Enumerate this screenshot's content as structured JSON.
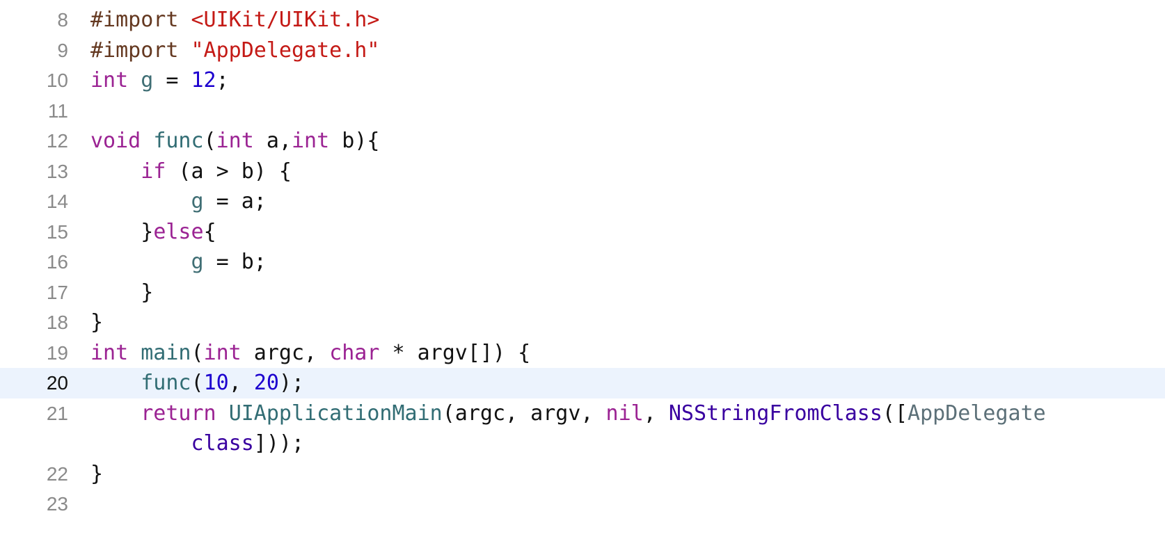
{
  "editor": {
    "lines": [
      {
        "num": "8",
        "tokens": [
          {
            "text": "#import ",
            "kind": "pp"
          },
          {
            "text": "<UIKit/UIKit.h>",
            "kind": "str"
          }
        ]
      },
      {
        "num": "9",
        "tokens": [
          {
            "text": "#import ",
            "kind": "pp"
          },
          {
            "text": "\"AppDelegate.h\"",
            "kind": "str"
          }
        ]
      },
      {
        "num": "10",
        "tokens": [
          {
            "text": "int",
            "kind": "kw"
          },
          {
            "text": " ",
            "kind": "plain"
          },
          {
            "text": "g",
            "kind": "gv"
          },
          {
            "text": " = ",
            "kind": "plain"
          },
          {
            "text": "12",
            "kind": "num"
          },
          {
            "text": ";",
            "kind": "plain"
          }
        ]
      },
      {
        "num": "11",
        "tokens": []
      },
      {
        "num": "12",
        "tokens": [
          {
            "text": "void",
            "kind": "kw"
          },
          {
            "text": " ",
            "kind": "plain"
          },
          {
            "text": "func",
            "kind": "fn"
          },
          {
            "text": "(",
            "kind": "plain"
          },
          {
            "text": "int",
            "kind": "kw"
          },
          {
            "text": " a,",
            "kind": "plain"
          },
          {
            "text": "int",
            "kind": "kw"
          },
          {
            "text": " b){",
            "kind": "plain"
          }
        ]
      },
      {
        "num": "13",
        "tokens": [
          {
            "text": "    ",
            "kind": "plain"
          },
          {
            "text": "if",
            "kind": "kw"
          },
          {
            "text": " (a > b) {",
            "kind": "plain"
          }
        ]
      },
      {
        "num": "14",
        "tokens": [
          {
            "text": "        ",
            "kind": "plain"
          },
          {
            "text": "g",
            "kind": "gv"
          },
          {
            "text": " = a;",
            "kind": "plain"
          }
        ]
      },
      {
        "num": "15",
        "tokens": [
          {
            "text": "    }",
            "kind": "plain"
          },
          {
            "text": "else",
            "kind": "kw"
          },
          {
            "text": "{",
            "kind": "plain"
          }
        ]
      },
      {
        "num": "16",
        "tokens": [
          {
            "text": "        ",
            "kind": "plain"
          },
          {
            "text": "g",
            "kind": "gv"
          },
          {
            "text": " = b;",
            "kind": "plain"
          }
        ]
      },
      {
        "num": "17",
        "tokens": [
          {
            "text": "    }",
            "kind": "plain"
          }
        ]
      },
      {
        "num": "18",
        "tokens": [
          {
            "text": "}",
            "kind": "plain"
          }
        ]
      },
      {
        "num": "19",
        "tokens": [
          {
            "text": "int",
            "kind": "kw"
          },
          {
            "text": " ",
            "kind": "plain"
          },
          {
            "text": "main",
            "kind": "fn"
          },
          {
            "text": "(",
            "kind": "plain"
          },
          {
            "text": "int",
            "kind": "kw"
          },
          {
            "text": " argc, ",
            "kind": "plain"
          },
          {
            "text": "char",
            "kind": "kw"
          },
          {
            "text": " * argv[]) {",
            "kind": "plain"
          }
        ]
      },
      {
        "num": "20",
        "current": true,
        "tokens": [
          {
            "text": "    ",
            "kind": "plain"
          },
          {
            "text": "func",
            "kind": "fn"
          },
          {
            "text": "(",
            "kind": "plain"
          },
          {
            "text": "10",
            "kind": "num"
          },
          {
            "text": ", ",
            "kind": "plain"
          },
          {
            "text": "20",
            "kind": "num"
          },
          {
            "text": ");",
            "kind": "plain"
          }
        ]
      },
      {
        "num": "21",
        "tokens": [
          {
            "text": "    ",
            "kind": "plain"
          },
          {
            "text": "return",
            "kind": "kw"
          },
          {
            "text": " ",
            "kind": "plain"
          },
          {
            "text": "UIApplicationMain",
            "kind": "fn"
          },
          {
            "text": "(argc, argv, ",
            "kind": "plain"
          },
          {
            "text": "nil",
            "kind": "kw"
          },
          {
            "text": ", ",
            "kind": "plain"
          },
          {
            "text": "NSStringFromClass",
            "kind": "sys"
          },
          {
            "text": "([",
            "kind": "plain"
          },
          {
            "text": "AppDelegate",
            "kind": "cls"
          }
        ],
        "wrap_tokens": [
          {
            "text": "        ",
            "kind": "plain"
          },
          {
            "text": "class",
            "kind": "sys"
          },
          {
            "text": "]));",
            "kind": "plain"
          }
        ]
      },
      {
        "num": "22",
        "tokens": [
          {
            "text": "}",
            "kind": "plain"
          }
        ]
      },
      {
        "num": "23",
        "tokens": []
      }
    ]
  },
  "colors": {
    "keyword": "#9b2393",
    "preprocessor": "#643820",
    "string": "#c41a16",
    "number": "#1c00cf",
    "function": "#326d74",
    "global_variable": "#3f6e74",
    "system": "#3900a0",
    "class": "#5c7078",
    "current_line_background": "#ecf3fd"
  }
}
